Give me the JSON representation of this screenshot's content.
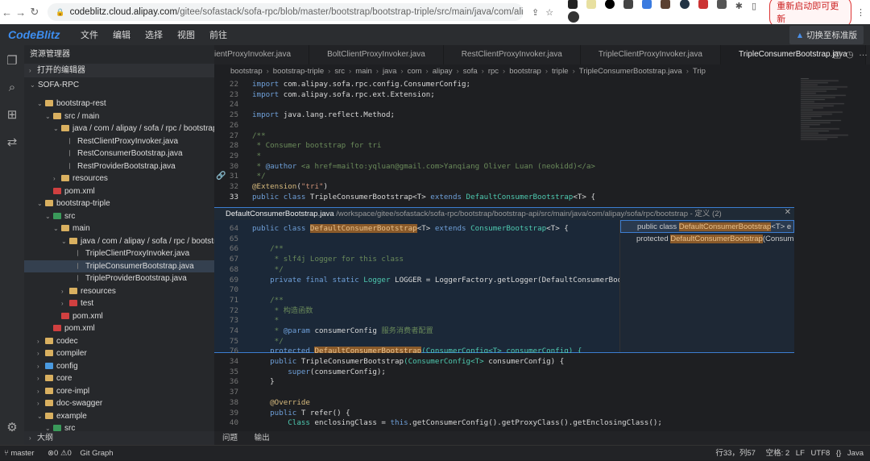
{
  "browser": {
    "url_host": "codeblitz.cloud.alipay.com",
    "url_path": "/gitee/sofastack/sofa-rpc/blob/master/bootstrap/bootstrap-triple/src/main/java/com/alipa...",
    "update_button": "重新启动即可更新"
  },
  "menubar": {
    "logo": "CodeBlitz",
    "items": [
      "文件",
      "编辑",
      "选择",
      "视图",
      "前往"
    ],
    "switch_button": "切换至标准版"
  },
  "sidebar": {
    "title": "资源管理器",
    "open_editors": "打开的编辑器",
    "project": "SOFA-RPC",
    "outline": "大纲",
    "tree": [
      {
        "label": "bootstrap-rest",
        "depth": 1,
        "chev": "v",
        "icon": "folder"
      },
      {
        "label": "src / main",
        "depth": 2,
        "chev": "v",
        "icon": "folder"
      },
      {
        "label": "java / com / alipay / sofa / rpc / bootstrap...",
        "depth": 3,
        "chev": "v",
        "icon": "folder"
      },
      {
        "label": "RestClientProxyInvoker.java",
        "depth": 4,
        "chev": "",
        "icon": "java"
      },
      {
        "label": "RestConsumerBootstrap.java",
        "depth": 4,
        "chev": "",
        "icon": "java"
      },
      {
        "label": "RestProviderBootstrap.java",
        "depth": 4,
        "chev": "",
        "icon": "java"
      },
      {
        "label": "resources",
        "depth": 3,
        "chev": ">",
        "icon": "folder"
      },
      {
        "label": "pom.xml",
        "depth": 2,
        "chev": "",
        "icon": "maven"
      },
      {
        "label": "bootstrap-triple",
        "depth": 1,
        "chev": "v",
        "icon": "folder"
      },
      {
        "label": "src",
        "depth": 2,
        "chev": "v",
        "icon": "src"
      },
      {
        "label": "main",
        "depth": 3,
        "chev": "v",
        "icon": "folder"
      },
      {
        "label": "java / com / alipay / sofa / rpc / bootstra...",
        "depth": 4,
        "chev": "v",
        "icon": "folder"
      },
      {
        "label": "TripleClientProxyInvoker.java",
        "depth": 5,
        "chev": "",
        "icon": "java"
      },
      {
        "label": "TripleConsumerBootstrap.java",
        "depth": 5,
        "chev": "",
        "icon": "java",
        "selected": true
      },
      {
        "label": "TripleProviderBootstrap.java",
        "depth": 5,
        "chev": "",
        "icon": "java"
      },
      {
        "label": "resources",
        "depth": 4,
        "chev": ">",
        "icon": "folder"
      },
      {
        "label": "test",
        "depth": 4,
        "chev": ">",
        "icon": "test"
      },
      {
        "label": "pom.xml",
        "depth": 3,
        "chev": "",
        "icon": "maven"
      },
      {
        "label": "pom.xml",
        "depth": 2,
        "chev": "",
        "icon": "maven"
      },
      {
        "label": "codec",
        "depth": 1,
        "chev": ">",
        "icon": "folder"
      },
      {
        "label": "compiler",
        "depth": 1,
        "chev": ">",
        "icon": "folder"
      },
      {
        "label": "config",
        "depth": 1,
        "chev": ">",
        "icon": "config"
      },
      {
        "label": "core",
        "depth": 1,
        "chev": ">",
        "icon": "folder"
      },
      {
        "label": "core-impl",
        "depth": 1,
        "chev": ">",
        "icon": "folder"
      },
      {
        "label": "doc-swagger",
        "depth": 1,
        "chev": ">",
        "icon": "folder"
      },
      {
        "label": "example",
        "depth": 1,
        "chev": "v",
        "icon": "folder"
      },
      {
        "label": "src",
        "depth": 2,
        "chev": "v",
        "icon": "src"
      }
    ]
  },
  "tabs": [
    "ientProxyInvoker.java",
    "BoltClientProxyInvoker.java",
    "RestClientProxyInvoker.java",
    "TripleClientProxyInvoker.java",
    "TripleConsumerBootstrap.java"
  ],
  "active_tab": 4,
  "breadcrumb": [
    "bootstrap",
    "bootstrap-triple",
    "src",
    "main",
    "java",
    "com",
    "alipay",
    "sofa",
    "rpc",
    "bootstrap",
    "triple",
    "TripleConsumerBootstrap.java",
    "Trip"
  ],
  "editor_top": [
    {
      "n": "22",
      "tk": [
        [
          "import ",
          "k"
        ],
        [
          "com.alipay.sofa.rpc.config.ConsumerConfig;",
          "t"
        ]
      ]
    },
    {
      "n": "23",
      "tk": [
        [
          "import ",
          "k"
        ],
        [
          "com.alipay.sofa.rpc.ext.Extension;",
          "t"
        ]
      ]
    },
    {
      "n": "24",
      "tk": []
    },
    {
      "n": "25",
      "tk": [
        [
          "import ",
          "k"
        ],
        [
          "java.lang.reflect.Method;",
          "t"
        ]
      ]
    },
    {
      "n": "26",
      "tk": []
    },
    {
      "n": "27",
      "tk": [
        [
          "/**",
          "c"
        ]
      ]
    },
    {
      "n": "28",
      "tk": [
        [
          " * Consumer bootstrap for tri",
          "c"
        ]
      ]
    },
    {
      "n": "29",
      "tk": [
        [
          " *",
          "c"
        ]
      ]
    },
    {
      "n": "30",
      "tk": [
        [
          " * ",
          "c"
        ],
        [
          "@author",
          "k"
        ],
        [
          " <a href=mailto:yqluan@gmail.com>Yanqiang Oliver Luan (neokidd)</a>",
          "c"
        ]
      ]
    },
    {
      "n": "31",
      "tk": [
        [
          " */",
          "c"
        ]
      ]
    },
    {
      "n": "32",
      "tk": [
        [
          "@Extension",
          "a"
        ],
        [
          "(",
          "t"
        ],
        [
          "\"tri\"",
          "s"
        ],
        [
          ")",
          "t"
        ]
      ]
    },
    {
      "n": "33",
      "tk": [
        [
          "public class ",
          "k"
        ],
        [
          "TripleConsumerBootstrap<T> ",
          "t"
        ],
        [
          "extends ",
          "k"
        ],
        [
          "DefaultConsumerBootstrap",
          "ty"
        ],
        [
          "<T> {",
          "t"
        ]
      ]
    }
  ],
  "peek": {
    "file": "DefaultConsumerBootstrap.java",
    "path": "/workspace/gitee/sofastack/sofa-rpc/bootstrap/bootstrap-api/src/main/java/com/alipay/sofa/rpc/bootstrap - 定义 (2)",
    "lines": [
      {
        "n": "64",
        "tk": [
          [
            "public class ",
            "k"
          ],
          [
            "DefaultConsumerBootstrap",
            "hl"
          ],
          [
            "<T> ",
            "t"
          ],
          [
            "extends ",
            "k"
          ],
          [
            "ConsumerBootstrap",
            "ty"
          ],
          [
            "<T> {",
            "t"
          ]
        ]
      },
      {
        "n": "65",
        "tk": []
      },
      {
        "n": "66",
        "tk": [
          [
            "    /**",
            "c"
          ]
        ]
      },
      {
        "n": "67",
        "tk": [
          [
            "     * slf4j Logger for this class",
            "c"
          ]
        ]
      },
      {
        "n": "68",
        "tk": [
          [
            "     */",
            "c"
          ]
        ]
      },
      {
        "n": "69",
        "tk": [
          [
            "    private final static ",
            "k"
          ],
          [
            "Logger ",
            "ty"
          ],
          [
            "LOGGER = LoggerFactory.getLogger(DefaultConsumerBootstrap.",
            "t"
          ]
        ]
      },
      {
        "n": "70",
        "tk": []
      },
      {
        "n": "71",
        "tk": [
          [
            "    /**",
            "c"
          ]
        ]
      },
      {
        "n": "72",
        "tk": [
          [
            "     * 构造函数",
            "c"
          ]
        ]
      },
      {
        "n": "73",
        "tk": [
          [
            "     *",
            "c"
          ]
        ]
      },
      {
        "n": "74",
        "tk": [
          [
            "     * ",
            "c"
          ],
          [
            "@param ",
            "k"
          ],
          [
            "consumerConfig ",
            "t"
          ],
          [
            "服务消费者配置",
            "c"
          ]
        ]
      },
      {
        "n": "75",
        "tk": [
          [
            "     */",
            "c"
          ]
        ]
      },
      {
        "n": "76",
        "tk": [
          [
            "    protected ",
            "k"
          ],
          [
            "DefaultConsumerBootstrap",
            "hl"
          ],
          [
            "(ConsumerConfig<T> consumerConfig) {",
            "ty"
          ]
        ]
      }
    ],
    "refs": [
      {
        "pre": "public class ",
        "hl": "DefaultConsumerBootstrap",
        "post": "<T> e"
      },
      {
        "pre": "protected ",
        "hl": "DefaultConsumerBootstrap",
        "post": "(Consum"
      }
    ]
  },
  "editor_bottom": [
    {
      "n": "34",
      "tk": [
        [
          "    public ",
          "k"
        ],
        [
          "TripleConsumerBootstrap",
          "t"
        ],
        [
          "(ConsumerConfig<T> ",
          "ty"
        ],
        [
          "consumerConfig) {",
          "t"
        ]
      ]
    },
    {
      "n": "35",
      "tk": [
        [
          "        super",
          "k"
        ],
        [
          "(consumerConfig);",
          "t"
        ]
      ]
    },
    {
      "n": "36",
      "tk": [
        [
          "    }",
          "t"
        ]
      ]
    },
    {
      "n": "37",
      "tk": []
    },
    {
      "n": "38",
      "tk": [
        [
          "    @Override",
          "a"
        ]
      ]
    },
    {
      "n": "39",
      "tk": [
        [
          "    public ",
          "k"
        ],
        [
          "T refer() {",
          "t"
        ]
      ]
    },
    {
      "n": "40",
      "tk": [
        [
          "        Class ",
          "ty"
        ],
        [
          "enclosingClass = ",
          "t"
        ],
        [
          "this",
          "k"
        ],
        [
          ".getConsumerConfig().getProxyClass().getEnclosingClass();",
          "t"
        ]
      ]
    }
  ],
  "panel": {
    "tabs": [
      "问题",
      "输出"
    ]
  },
  "status": {
    "branch": "master",
    "errors": "0",
    "warnings": "0",
    "git_graph": "Git Graph",
    "position": "行33，列57",
    "spaces": "空格: 2",
    "eol": "LF",
    "encoding": "UTF8",
    "language": "Java"
  }
}
